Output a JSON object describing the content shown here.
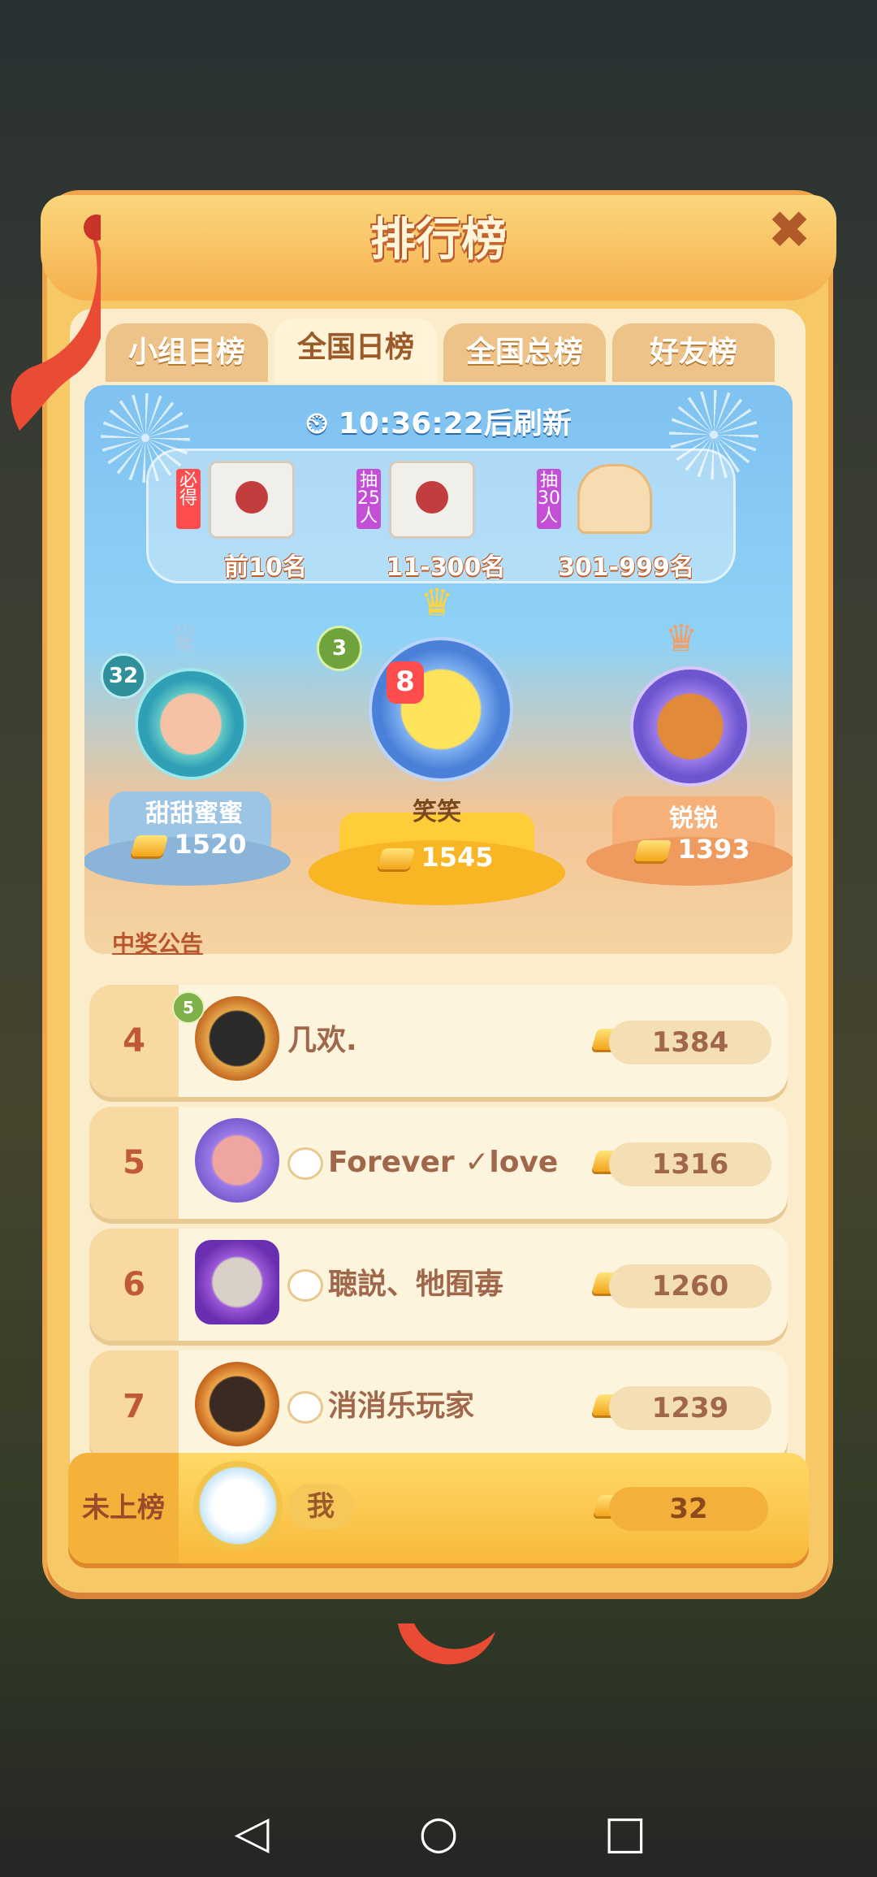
{
  "dialog": {
    "title": "排行榜",
    "close_icon": "close-icon"
  },
  "tabs": [
    {
      "label": "小组日榜",
      "active": false
    },
    {
      "label": "全国日榜",
      "active": true
    },
    {
      "label": "全国总榜",
      "active": false
    },
    {
      "label": "好友榜",
      "active": false
    }
  ],
  "banner": {
    "timer_text": "10:36:22后刷新",
    "prizes": [
      {
        "tag": "必得",
        "tag_color": "#ff4d4d",
        "icon": "tote-bag-icon",
        "label": "前10名"
      },
      {
        "tag": "抽25人",
        "tag_color": "#c24fd6",
        "icon": "tote-bag-icon",
        "label": "11-300名"
      },
      {
        "tag": "抽30人",
        "tag_color": "#c24fd6",
        "icon": "neck-pillow-icon",
        "label": "301-999名"
      }
    ]
  },
  "podium": {
    "first": {
      "rank": "1",
      "level": "3",
      "badge": "8",
      "name": "笑笑",
      "score": "1545"
    },
    "second": {
      "rank": "2",
      "level": "32",
      "name": "甜甜蜜蜜",
      "score": "1520"
    },
    "third": {
      "rank": "3",
      "name": "锐锐",
      "score": "1393"
    }
  },
  "notice_link": "中奖公告",
  "rows": [
    {
      "rank": "4",
      "level": "5",
      "name": "几欢.",
      "score": "1384"
    },
    {
      "rank": "5",
      "name": "Forever ✓love",
      "score": "1316"
    },
    {
      "rank": "6",
      "name": "聴説、牠囿毐",
      "score": "1260"
    },
    {
      "rank": "7",
      "name": "消消乐玩家",
      "score": "1239"
    }
  ],
  "me": {
    "rank": "未上榜",
    "name": "我",
    "score": "32"
  },
  "colors": {
    "accent": "#f6b04d",
    "text_brown": "#a0674a",
    "rank_red": "#c0583a"
  }
}
